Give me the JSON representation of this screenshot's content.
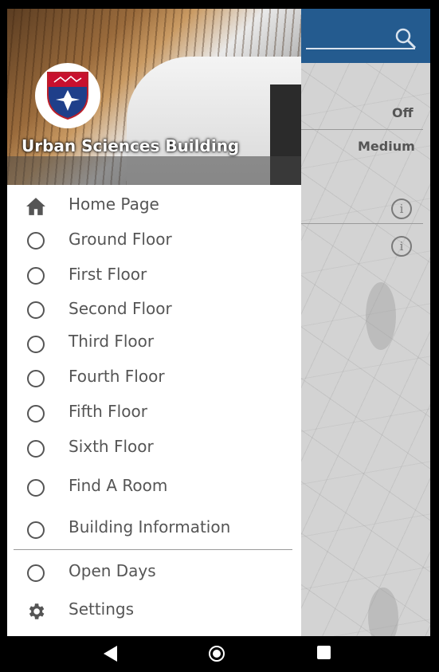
{
  "drawer": {
    "title": "Urban Sciences Building",
    "menu": [
      {
        "label": "Home Page",
        "icon": "home-icon"
      },
      {
        "label": "Ground Floor",
        "icon": "radio-icon"
      },
      {
        "label": "First Floor",
        "icon": "radio-icon"
      },
      {
        "label": "Second Floor",
        "icon": "radio-icon"
      },
      {
        "label": "Third Floor",
        "icon": "radio-icon"
      },
      {
        "label": "Fourth Floor",
        "icon": "radio-icon"
      },
      {
        "label": "Fifth Floor",
        "icon": "radio-icon"
      },
      {
        "label": "Sixth Floor",
        "icon": "radio-icon"
      },
      {
        "label": "Find A Room",
        "icon": "radio-icon"
      },
      {
        "label": "Building Information",
        "icon": "radio-icon"
      },
      {
        "label": "Open Days",
        "icon": "radio-icon"
      },
      {
        "label": "Settings",
        "icon": "gear-icon"
      }
    ]
  },
  "background_app": {
    "header_color": "#245b8f",
    "values": [
      "Off",
      "Medium"
    ]
  },
  "colors": {
    "accent": "#245b8f",
    "menu_text": "#555555"
  }
}
